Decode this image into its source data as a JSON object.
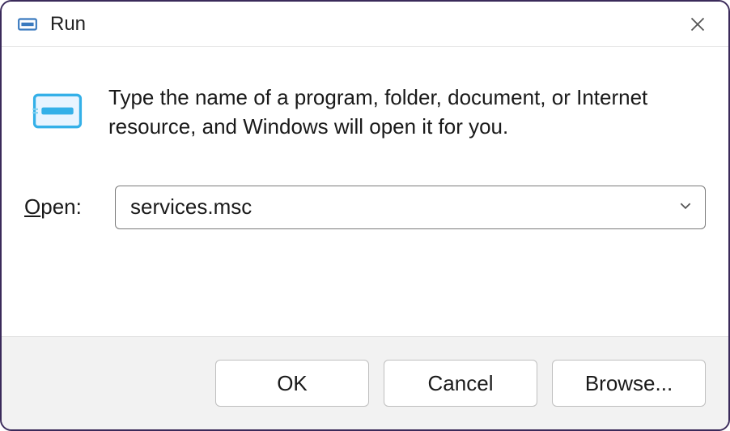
{
  "window": {
    "title": "Run"
  },
  "content": {
    "description": "Type the name of a program, folder, document, or Internet resource, and Windows will open it for you.",
    "open_label": "Open:",
    "input_value": "services.msc"
  },
  "buttons": {
    "ok": "OK",
    "cancel": "Cancel",
    "browse": "Browse..."
  }
}
